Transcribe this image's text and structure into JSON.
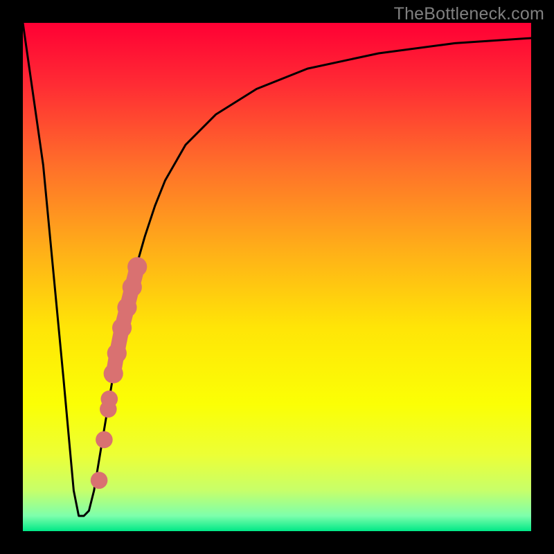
{
  "watermark": "TheBottleneck.com",
  "colors": {
    "frame": "#000000",
    "curve": "#000000",
    "marker": "#d97171",
    "gradient_stops": [
      {
        "pos": 0.0,
        "color": "#ff0034"
      },
      {
        "pos": 0.12,
        "color": "#ff2b34"
      },
      {
        "pos": 0.28,
        "color": "#ff6f2a"
      },
      {
        "pos": 0.45,
        "color": "#ffb018"
      },
      {
        "pos": 0.6,
        "color": "#ffe507"
      },
      {
        "pos": 0.75,
        "color": "#fbff05"
      },
      {
        "pos": 0.85,
        "color": "#ecff36"
      },
      {
        "pos": 0.92,
        "color": "#c7ff6a"
      },
      {
        "pos": 0.97,
        "color": "#7dffac"
      },
      {
        "pos": 1.0,
        "color": "#00e887"
      }
    ]
  },
  "chart_data": {
    "type": "line",
    "title": "",
    "xlabel": "",
    "ylabel": "",
    "xlim": [
      0,
      100
    ],
    "ylim": [
      0,
      100
    ],
    "series": [
      {
        "name": "curve",
        "x": [
          0,
          4,
          8,
          10,
          11,
          12,
          13,
          14,
          15,
          16,
          18,
          20,
          22,
          24,
          26,
          28,
          32,
          38,
          46,
          56,
          70,
          85,
          100
        ],
        "y": [
          100,
          72,
          30,
          8,
          3,
          3,
          4,
          8,
          14,
          20,
          32,
          42,
          51,
          58,
          64,
          69,
          76,
          82,
          87,
          91,
          94,
          96,
          97
        ]
      }
    ],
    "markers": [
      {
        "x": 15.0,
        "y": 10,
        "r": 1.4
      },
      {
        "x": 16.0,
        "y": 18,
        "r": 1.4
      },
      {
        "x": 16.8,
        "y": 24,
        "r": 1.4
      },
      {
        "x": 17.0,
        "y": 26,
        "r": 1.4
      },
      {
        "x": 17.8,
        "y": 31,
        "r": 1.6
      },
      {
        "x": 18.5,
        "y": 35,
        "r": 1.6
      },
      {
        "x": 19.5,
        "y": 40,
        "r": 1.6
      },
      {
        "x": 20.5,
        "y": 44,
        "r": 1.6
      },
      {
        "x": 21.5,
        "y": 48,
        "r": 1.6
      },
      {
        "x": 22.5,
        "y": 52,
        "r": 1.6
      }
    ]
  }
}
